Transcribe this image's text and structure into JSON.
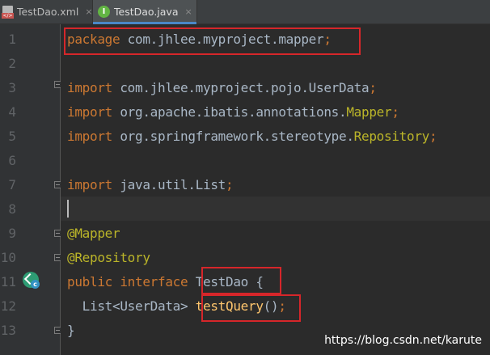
{
  "tabs": [
    {
      "label": "TestDao.xml",
      "icon": "xml-file-icon",
      "active": false,
      "close": "×"
    },
    {
      "label": "TestDao.java",
      "icon": "interface-file-icon",
      "icon_letter": "I",
      "active": true,
      "close": "×"
    }
  ],
  "line_numbers": [
    "1",
    "2",
    "3",
    "4",
    "5",
    "6",
    "7",
    "8",
    "9",
    "10",
    "11",
    "12",
    "13"
  ],
  "code": {
    "l1": {
      "kw": "package",
      "rest": " com.jhlee.myproject.mapper",
      "semi": ";"
    },
    "l3": {
      "kw": "import",
      "rest": " com.jhlee.myproject.pojo.UserData",
      "semi": ";"
    },
    "l4": {
      "kw": "import",
      "rest": " org.apache.ibatis.annotations.",
      "cls": "Mapper",
      "semi": ";"
    },
    "l5": {
      "kw": "import",
      "rest": " org.springframework.stereotype.",
      "cls": "Repository",
      "semi": ";"
    },
    "l7": {
      "kw": "import",
      "rest": " java.util.List",
      "semi": ";"
    },
    "l9": {
      "ann": "@Mapper"
    },
    "l10": {
      "ann": "@Repository"
    },
    "l11": {
      "kw1": "public",
      "kw2": "interface",
      "name": "TestDao",
      "brace": " {"
    },
    "l12": {
      "type": "  List<UserData> ",
      "method": "testQuery",
      "paren": "()",
      "semi": ";"
    },
    "l13": {
      "brace": "}"
    }
  },
  "gutter_icon": {
    "name": "implementation-icon",
    "badge": "c"
  },
  "watermark": "https://blog.csdn.net/karute",
  "colors": {
    "keyword": "#cc7832",
    "annotation": "#bbb529",
    "method": "#ffc66d",
    "text": "#a9b7c6",
    "highlight_box": "#d6262a",
    "background": "#2b2b2b"
  }
}
